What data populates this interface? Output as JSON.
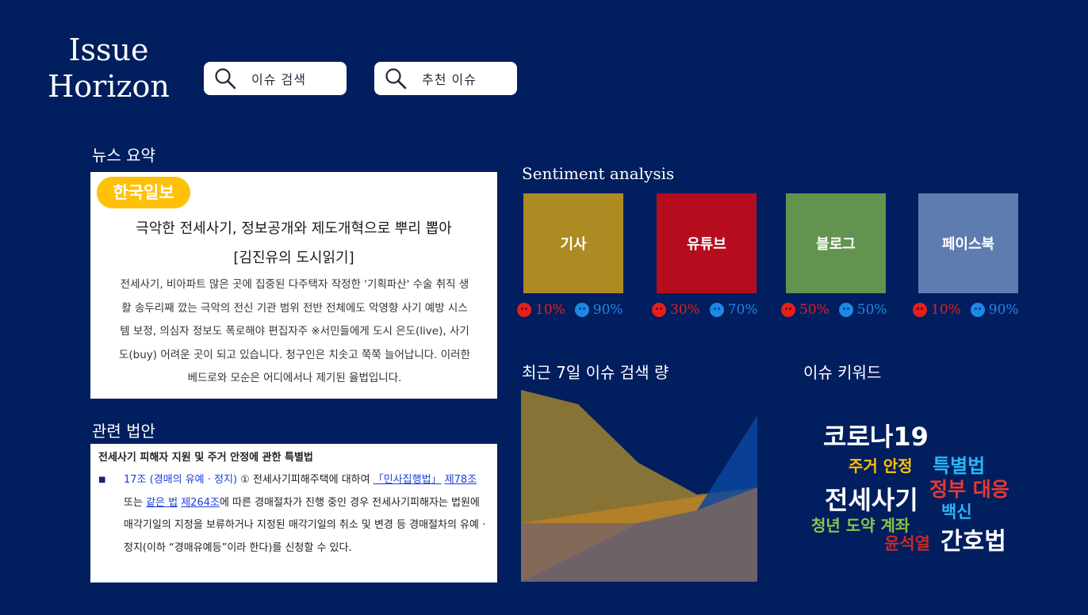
{
  "logo": {
    "line1": "Issue",
    "line2": "Horizon"
  },
  "search": [
    {
      "label": "이슈 검색",
      "icon": "search-icon"
    },
    {
      "label": "추천 이슈",
      "icon": "search-icon"
    }
  ],
  "news_summary": {
    "heading": "뉴스 요약",
    "source_badge": "한국일보",
    "title_line1": "극악한 전세사기, 정보공개와 제도개혁으로 뿌리 뽑아",
    "title_line2": "[김진유의 도시읽기]",
    "body_lines": [
      "전세사기, 비아파트 많은 곳에 집중된 다주택자 작정한 '기획파산' 수술 취직 생",
      "활 송두리째 깠는 극악의 전신 기관 범위 전반 전체에도 악영향 사기 예방 시스",
      "템 보정, 의심자 정보도 폭로해야 편집자주 ※서민들에게 도시 은도(live), 사기",
      "도(buy) 어려운 곳이 되고 있습니다. 청구인은 치솟고 쭉쭉 늘어납니다. 이러한",
      "베드로와 모순은 어디에서나 제기된 율법입니다."
    ]
  },
  "related_law": {
    "heading": "관련 법안",
    "title": "전세사기 피해자 지원 및 주거 안정에 관한 특별법",
    "article": "17조 (경매의 유예 · 정지)",
    "text_a": " ① 전세사기피해주택에 대하여 ",
    "link1": "「민사집행법」",
    "link2": "제78조",
    "text_b": " 또는 ",
    "link3": "같은 법",
    "text_c": " ",
    "link4": "제264조",
    "text_d": "에 따른 경매절차가 진행 중인 경우 전세사기피해자는 법원에 매각기일의 지정을 보류하거나 지정된 매각기일의 취소 및 변경 등 경매절차의 유예 · 정지(이하 “경매유예등”이라 한다)를 신청할 수 있다."
  },
  "sentiment": {
    "heading": "Sentiment analysis",
    "sources": [
      {
        "name": "기사",
        "color": "#ad8b23",
        "negative": "10%",
        "positive": "90%"
      },
      {
        "name": "유튜브",
        "color": "#b50d1e",
        "negative": "30%",
        "positive": "70%"
      },
      {
        "name": "블로그",
        "color": "#629450",
        "negative": "50%",
        "positive": "50%"
      },
      {
        "name": "페이스북",
        "color": "#5f7cb1",
        "negative": "10%",
        "positive": "90%"
      }
    ]
  },
  "search_volume": {
    "heading": "최근 7일 이슈 검색 량"
  },
  "keywords": {
    "heading": "이슈 키워드",
    "items": [
      {
        "text": "코로나19",
        "color": "#ffffff"
      },
      {
        "text": "주거 안정",
        "color": "#ffc107"
      },
      {
        "text": "특별법",
        "color": "#29b6f6"
      },
      {
        "text": "전세사기",
        "color": "#ffffff"
      },
      {
        "text": "정부 대응",
        "color": "#e53935"
      },
      {
        "text": "백신",
        "color": "#29b6f6"
      },
      {
        "text": "청년 도약 계좌",
        "color": "#8bc34a"
      },
      {
        "text": "윤석열",
        "color": "#c62828"
      },
      {
        "text": "간호법",
        "color": "#ffffff"
      }
    ]
  }
}
